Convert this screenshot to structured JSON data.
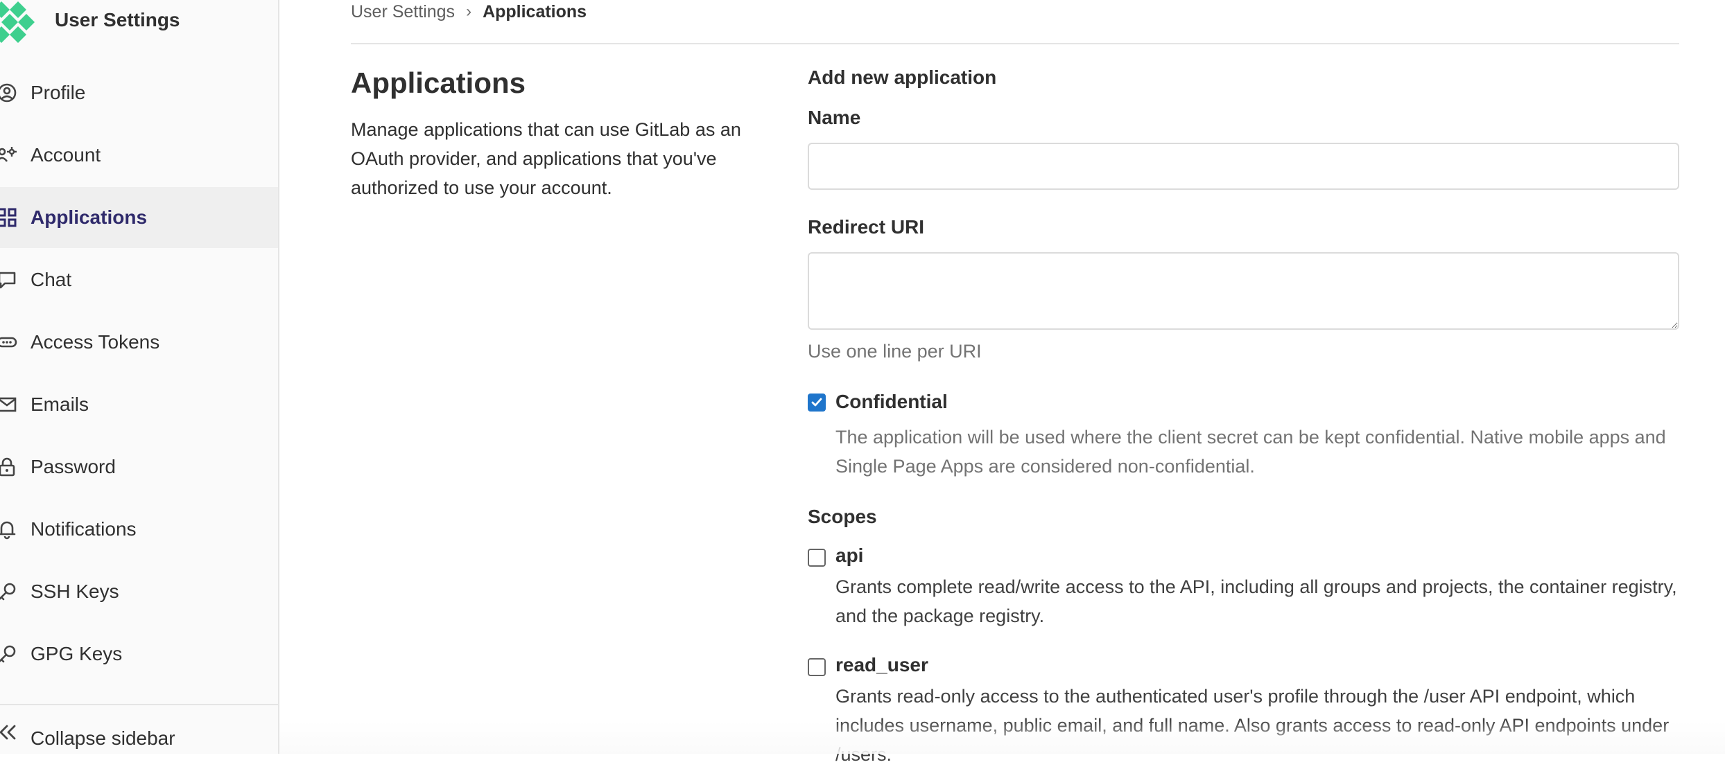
{
  "sidebar": {
    "title": "User Settings",
    "items": [
      {
        "label": "Profile",
        "icon": "profile-icon"
      },
      {
        "label": "Account",
        "icon": "account-icon"
      },
      {
        "label": "Applications",
        "icon": "applications-icon",
        "active": true
      },
      {
        "label": "Chat",
        "icon": "chat-icon"
      },
      {
        "label": "Access Tokens",
        "icon": "token-icon"
      },
      {
        "label": "Emails",
        "icon": "mail-icon"
      },
      {
        "label": "Password",
        "icon": "lock-icon"
      },
      {
        "label": "Notifications",
        "icon": "bell-icon"
      },
      {
        "label": "SSH Keys",
        "icon": "key-icon"
      },
      {
        "label": "GPG Keys",
        "icon": "key-icon"
      }
    ],
    "collapse_label": "Collapse sidebar"
  },
  "breadcrumb": {
    "parent": "User Settings",
    "separator": "›",
    "current": "Applications"
  },
  "page": {
    "title": "Applications",
    "description": "Manage applications that can use GitLab as an OAuth provider, and applications that you've authorized to use your account."
  },
  "form": {
    "heading": "Add new application",
    "name_label": "Name",
    "name_value": "",
    "redirect_label": "Redirect URI",
    "redirect_value": "",
    "redirect_help": "Use one line per URI",
    "confidential": {
      "label": "Confidential",
      "checked": true,
      "description": "The application will be used where the client secret can be kept confidential. Native mobile apps and Single Page Apps are considered non-confidential."
    },
    "scopes_label": "Scopes",
    "scopes": [
      {
        "name": "api",
        "checked": false,
        "description": "Grants complete read/write access to the API, including all groups and projects, the container registry, and the package registry."
      },
      {
        "name": "read_user",
        "checked": false,
        "description": "Grants read-only access to the authenticated user's profile through the /user API endpoint, which includes username, public email, and full name. Also grants access to read-only API endpoints under /users."
      }
    ]
  },
  "colors": {
    "accent": "#1f75cb",
    "active_nav_text": "#2f2a6b",
    "logo_green": "#3ecf8e"
  }
}
